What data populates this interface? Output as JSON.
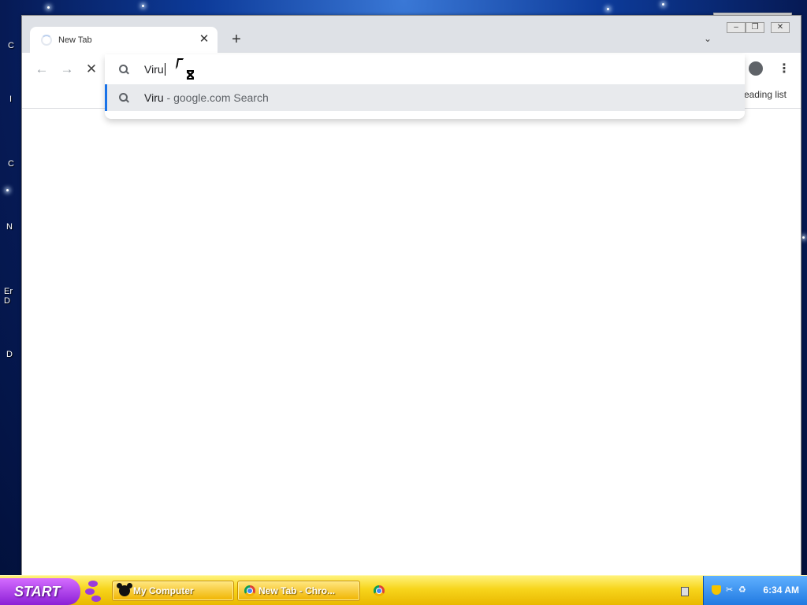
{
  "desktop": {
    "labels": [
      "C",
      "I",
      "C",
      "N",
      "Er\nD",
      "D"
    ]
  },
  "browser": {
    "tab": {
      "title": "New Tab"
    },
    "bookmarks": {
      "reading_list": "eading list"
    },
    "omnibox": {
      "input_text": "Viru",
      "suggestion": {
        "query": "Viru",
        "separator": " - ",
        "engine": "google.com Search"
      }
    }
  },
  "taskbar": {
    "start_label": "START",
    "buttons": [
      {
        "label": "My Computer",
        "icon": "mickey-icon"
      },
      {
        "label": "New Tab - Chro...",
        "icon": "chrome-icon"
      }
    ],
    "clock": "6:34 AM"
  },
  "colors": {
    "accent_blue": "#1a73e8",
    "taskbar_yellow": "#f7d51c",
    "start_purple": "#8b1fd6",
    "tray_blue": "#1f78e0"
  }
}
